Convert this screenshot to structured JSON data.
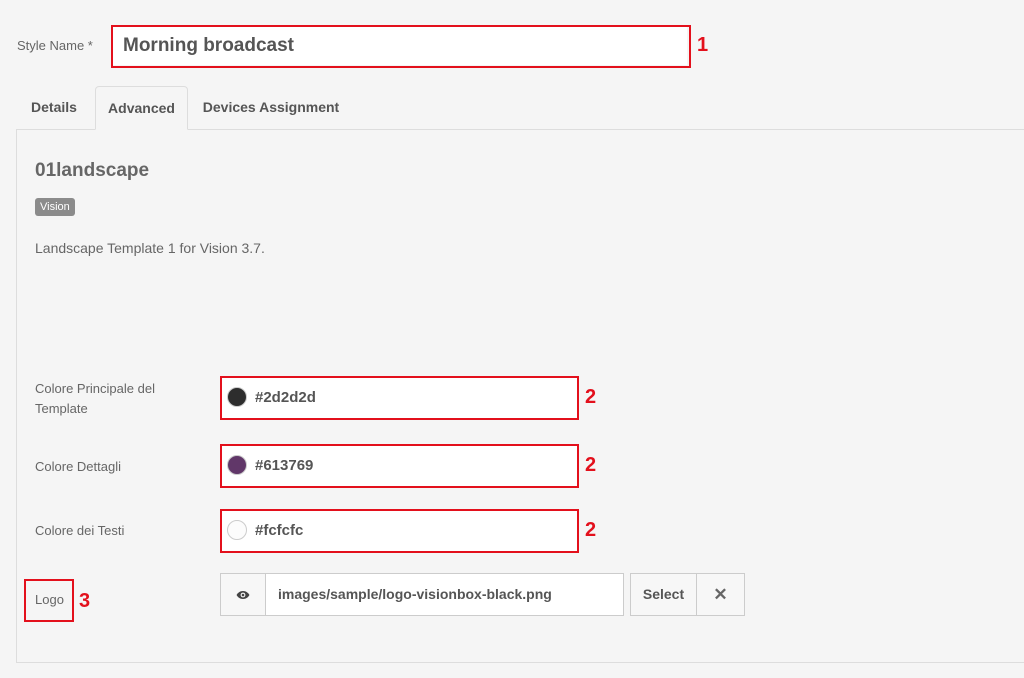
{
  "form": {
    "style_name_label": "Style Name *",
    "style_name_value": "Morning broadcast"
  },
  "tabs": [
    {
      "label": "Details"
    },
    {
      "label": "Advanced"
    },
    {
      "label": "Devices Assignment"
    }
  ],
  "template": {
    "title": "01landscape",
    "badge": "Vision",
    "description": "Landscape Template 1 for Vision 3.7."
  },
  "colors": [
    {
      "label": "Colore Principale del Template",
      "value": "#2d2d2d",
      "swatch": "#2d2d2d"
    },
    {
      "label": "Colore Dettagli",
      "value": "#613769",
      "swatch": "#613769"
    },
    {
      "label": "Colore dei Testi",
      "value": "#fcfcfc",
      "swatch": "#fcfcfc"
    }
  ],
  "logo": {
    "label": "Logo",
    "path": "images/sample/logo-visionbox-black.png",
    "select_label": "Select",
    "preview_icon": "eye-icon",
    "clear_icon": "close-icon"
  },
  "annotations": {
    "n1": "1",
    "n2": "2",
    "n3": "3"
  },
  "accent_color": "#e3101c"
}
